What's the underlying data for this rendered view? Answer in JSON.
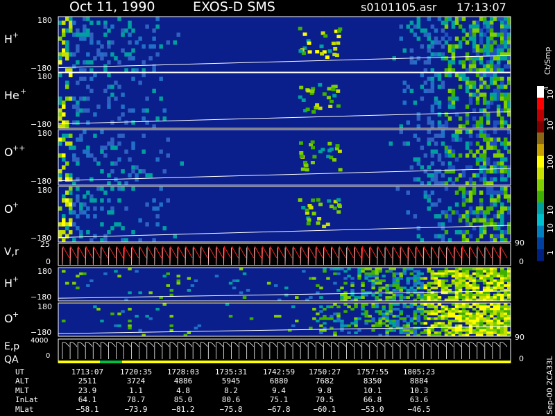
{
  "header": {
    "date": "Oct 11, 1990",
    "mission": "EXOS-D SMS",
    "file": "s0101105.asr",
    "time": "17:13:07"
  },
  "colorbar": {
    "unit_label": "Ct/Smp",
    "ticks": [
      "10",
      "10",
      "100",
      "10",
      "10",
      "1"
    ],
    "tick_exponents": [
      "4",
      "3",
      "",
      "",
      "",
      ""
    ],
    "colors": [
      "#ffffff",
      "#ff0000",
      "#c00000",
      "#800000",
      "#8b6914",
      "#c8a000",
      "#ffff00",
      "#c8e000",
      "#80d000",
      "#40b000",
      "#00a0a0",
      "#00c0d0",
      "#0080c0",
      "#0040a0",
      "#002080"
    ]
  },
  "vr_panel": {
    "label": "V,r",
    "ymax": "25",
    "ymin": "0",
    "right_top": "90",
    "right_bottom": "0"
  },
  "ep_panel": {
    "label_e": "E,p",
    "label_q": "QA",
    "ymax": "4000",
    "ymin": "0",
    "right_top": "90",
    "right_bottom": "0"
  },
  "side_label": "Sep-00  2CA33L",
  "ephemeris": {
    "labels": [
      "UT",
      "ALT",
      "MLT",
      "InLat",
      "MLat"
    ],
    "rows": [
      [
        "1713:07",
        "1720:35",
        "1728:03",
        "1735:31",
        "1742:59",
        "1750:27",
        "1757:55",
        "1805:23"
      ],
      [
        "2511",
        "3724",
        "4886",
        "5945",
        "6880",
        "7682",
        "8350",
        "8884"
      ],
      [
        "23.9",
        "1.1",
        "4.8",
        "8.2",
        "9.4",
        "9.8",
        "10.1",
        "10.3"
      ],
      [
        "64.1",
        "78.7",
        "85.0",
        "80.6",
        "75.1",
        "70.5",
        "66.8",
        "63.6"
      ],
      [
        "-58.1",
        "-73.9",
        "-81.2",
        "-75.8",
        "-67.8",
        "-60.1",
        "-53.0",
        "-46.5"
      ]
    ]
  },
  "chart_data": {
    "type": "heatmap",
    "title": "Oct 11, 1990   EXOS-D SMS",
    "colorbar_label": "Ct/Smp",
    "colorbar_scale": "log",
    "colorbar_range": [
      1,
      10000
    ],
    "x_ticks": [
      "1713:07",
      "1720:35",
      "1728:03",
      "1735:31",
      "1742:59",
      "1750:27",
      "1757:55",
      "1805:23"
    ],
    "panels": [
      {
        "label": "H",
        "charge": "+",
        "ymax": "180",
        "ymin": "-180"
      },
      {
        "label": "He",
        "charge": "+",
        "ymax": "180",
        "ymin": "-180"
      },
      {
        "label": "O",
        "charge": "++",
        "ymax": "180",
        "ymin": "-180"
      },
      {
        "label": "O",
        "charge": "+",
        "ymax": "180",
        "ymin": "-180"
      },
      {
        "label": "H",
        "charge": "+",
        "ymax": "180",
        "ymin": "-180"
      },
      {
        "label": "O",
        "charge": "+",
        "ymax": "180",
        "ymin": "-180"
      }
    ]
  }
}
